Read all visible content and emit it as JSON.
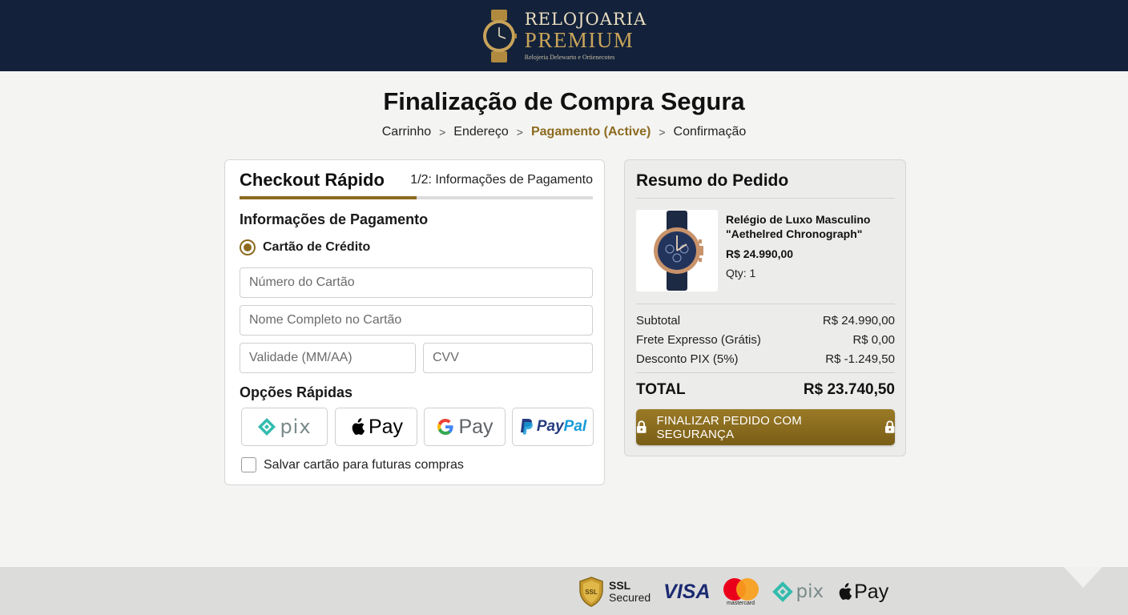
{
  "brand": {
    "name_line1": "RELOJOARIA",
    "name_line2": "PREMIUM",
    "tagline": "Relojeria Delewarto e Ortienecotes"
  },
  "page": {
    "title": "Finalização de Compra Segura"
  },
  "breadcrumb": [
    {
      "label": "Carrinho"
    },
    {
      "label": "Endereço"
    },
    {
      "label": "Pagamento (Active)",
      "active": true
    },
    {
      "label": "Confirmação"
    }
  ],
  "checkout": {
    "title": "Checkout Rápido",
    "step": "1/2: Informações de Pagamento",
    "progress": 0.5,
    "section_payment": "Informações de Pagamento",
    "method_label": "Cartão de Crédito",
    "fields": {
      "card_number": "Número do Cartão",
      "card_name": "Nome Completo no Cartão",
      "expiry": "Validade (MM/AA)",
      "cvv": "CVV"
    },
    "quick_options_label": "Opções Rápidas",
    "quick_options": {
      "pix": "pix",
      "apple_pay": "Pay",
      "google_pay": "Pay",
      "paypal_1": "Pay",
      "paypal_2": "Pal"
    },
    "save_card_label": "Salvar cartão para futuras compras"
  },
  "summary": {
    "title": "Resumo do Pedido",
    "product": {
      "name": "Relégio de Luxo Masculino \"Aethelred Chronograph\"",
      "price": "R$ 24.990,00",
      "qty": "Qty: 1"
    },
    "lines": [
      {
        "label": "Subtotal",
        "value": "R$ 24.990,00"
      },
      {
        "label": "Frete Expresso (Grátis)",
        "value": "R$ 0,00"
      },
      {
        "label": "Desconto PIX (5%)",
        "value": "R$ -1.249,50"
      }
    ],
    "total_label": "TOTAL",
    "total_value": "R$ 23.740,50",
    "cta_label": "FINALIZAR PEDIDO COM SEGURANÇA"
  },
  "footer": {
    "ssl_line1": "SSL",
    "ssl_line2": "Secured",
    "ssl_badge": "SSL",
    "visa": "VISA",
    "mastercard": "mastercard",
    "pix": "pix",
    "apple_pay": "Pay"
  },
  "colors": {
    "header_bg": "#13223a",
    "accent_gold": "#8c6b1f",
    "page_bg": "#f4f4f3"
  }
}
